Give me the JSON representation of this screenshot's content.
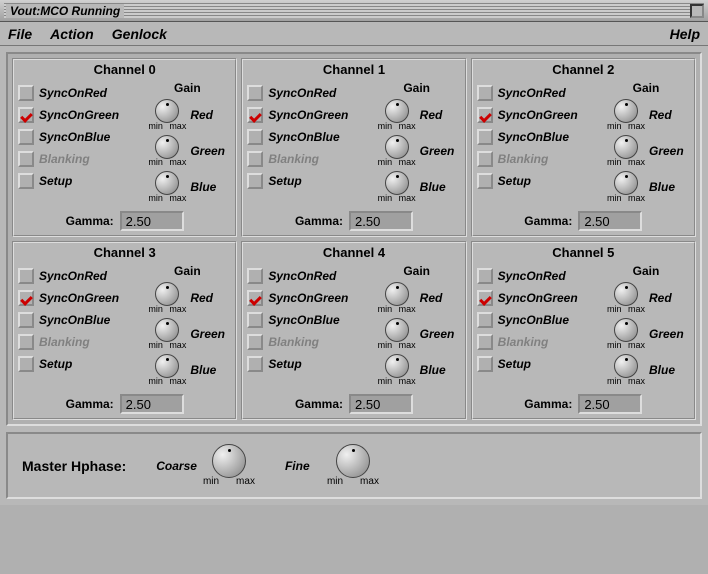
{
  "window": {
    "title": "Vout:MCO Running"
  },
  "menu": {
    "file": "File",
    "action": "Action",
    "genlock": "Genlock",
    "help": "Help"
  },
  "labels": {
    "gain": "Gain",
    "red": "Red",
    "green": "Green",
    "blue": "Blue",
    "min": "min",
    "max": "max",
    "gamma": "Gamma:",
    "syncOnRed": "SyncOnRed",
    "syncOnGreen": "SyncOnGreen",
    "syncOnBlue": "SyncOnBlue",
    "blanking": "Blanking",
    "setup": "Setup"
  },
  "channels": [
    {
      "title": "Channel 0",
      "syncOnRed": false,
      "syncOnGreen": true,
      "syncOnBlue": false,
      "blanking": false,
      "blankingEnabled": false,
      "setup": false,
      "gamma": "2.50"
    },
    {
      "title": "Channel 1",
      "syncOnRed": false,
      "syncOnGreen": true,
      "syncOnBlue": false,
      "blanking": false,
      "blankingEnabled": false,
      "setup": false,
      "gamma": "2.50"
    },
    {
      "title": "Channel 2",
      "syncOnRed": false,
      "syncOnGreen": true,
      "syncOnBlue": false,
      "blanking": false,
      "blankingEnabled": false,
      "setup": false,
      "gamma": "2.50"
    },
    {
      "title": "Channel 3",
      "syncOnRed": false,
      "syncOnGreen": true,
      "syncOnBlue": false,
      "blanking": false,
      "blankingEnabled": false,
      "setup": false,
      "gamma": "2.50"
    },
    {
      "title": "Channel 4",
      "syncOnRed": false,
      "syncOnGreen": true,
      "syncOnBlue": false,
      "blanking": false,
      "blankingEnabled": false,
      "setup": false,
      "gamma": "2.50"
    },
    {
      "title": "Channel 5",
      "syncOnRed": false,
      "syncOnGreen": true,
      "syncOnBlue": false,
      "blanking": false,
      "blankingEnabled": false,
      "setup": false,
      "gamma": "2.50"
    }
  ],
  "master": {
    "label": "Master Hphase:",
    "coarse": "Coarse",
    "fine": "Fine"
  }
}
